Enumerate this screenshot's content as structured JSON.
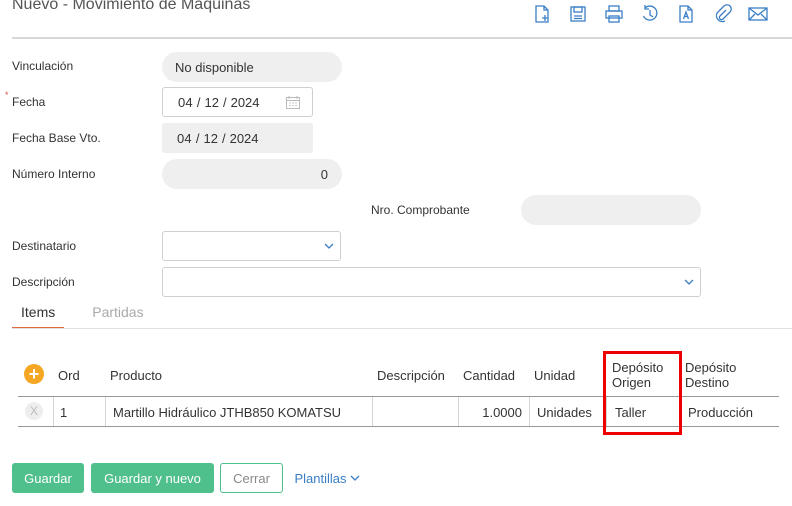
{
  "page": {
    "title": "Nuevo - Movimiento de Máquinas"
  },
  "toolbar": {
    "icons": [
      "new-document-icon",
      "save-icon",
      "print-icon",
      "history-icon",
      "text-document-icon",
      "attachment-icon",
      "email-icon"
    ]
  },
  "form": {
    "vinculacion": {
      "label": "Vinculación",
      "value": "No disponible"
    },
    "fecha": {
      "label": "Fecha",
      "required_mark": "*",
      "day": "04",
      "month": "12",
      "year": "2024",
      "sep": "/"
    },
    "fecha_base": {
      "label": "Fecha Base Vto.",
      "day": "04",
      "month": "12",
      "year": "2024",
      "sep": "/"
    },
    "numero_interno": {
      "label": "Número Interno",
      "value": "0"
    },
    "nro_comprobante": {
      "label": "Nro. Comprobante",
      "value": ""
    },
    "destinatario": {
      "label": "Destinatario",
      "value": ""
    },
    "descripcion": {
      "label": "Descripción",
      "value": ""
    }
  },
  "tabs": [
    {
      "label": "Items",
      "active": true
    },
    {
      "label": "Partidas",
      "active": false
    }
  ],
  "grid": {
    "headers": {
      "ord": "Ord",
      "producto": "Producto",
      "descripcion": "Descripción",
      "cantidad": "Cantidad",
      "unidad": "Unidad",
      "deposito_origen_1": "Depósito",
      "deposito_origen_2": "Origen",
      "deposito_destino_1": "Depósito",
      "deposito_destino_2": "Destino"
    },
    "add_symbol": "+",
    "delete_symbol": "X",
    "rows": [
      {
        "ord": "1",
        "producto": "Martillo Hidráulico JTHB850 KOMATSU",
        "descripcion": "",
        "cantidad": "1.0000",
        "unidad": "Unidades",
        "deposito_origen": "Taller",
        "deposito_destino": "Producción"
      }
    ]
  },
  "buttons": {
    "guardar": "Guardar",
    "guardar_nuevo": "Guardar y nuevo",
    "cerrar": "Cerrar",
    "plantillas": "Plantillas"
  },
  "colors": {
    "accent_green": "#4fbf8c",
    "link_blue": "#3a7fc6",
    "highlight_red": "#ee0000",
    "tab_active": "#e06a3b",
    "add_orange": "#f5a623"
  }
}
